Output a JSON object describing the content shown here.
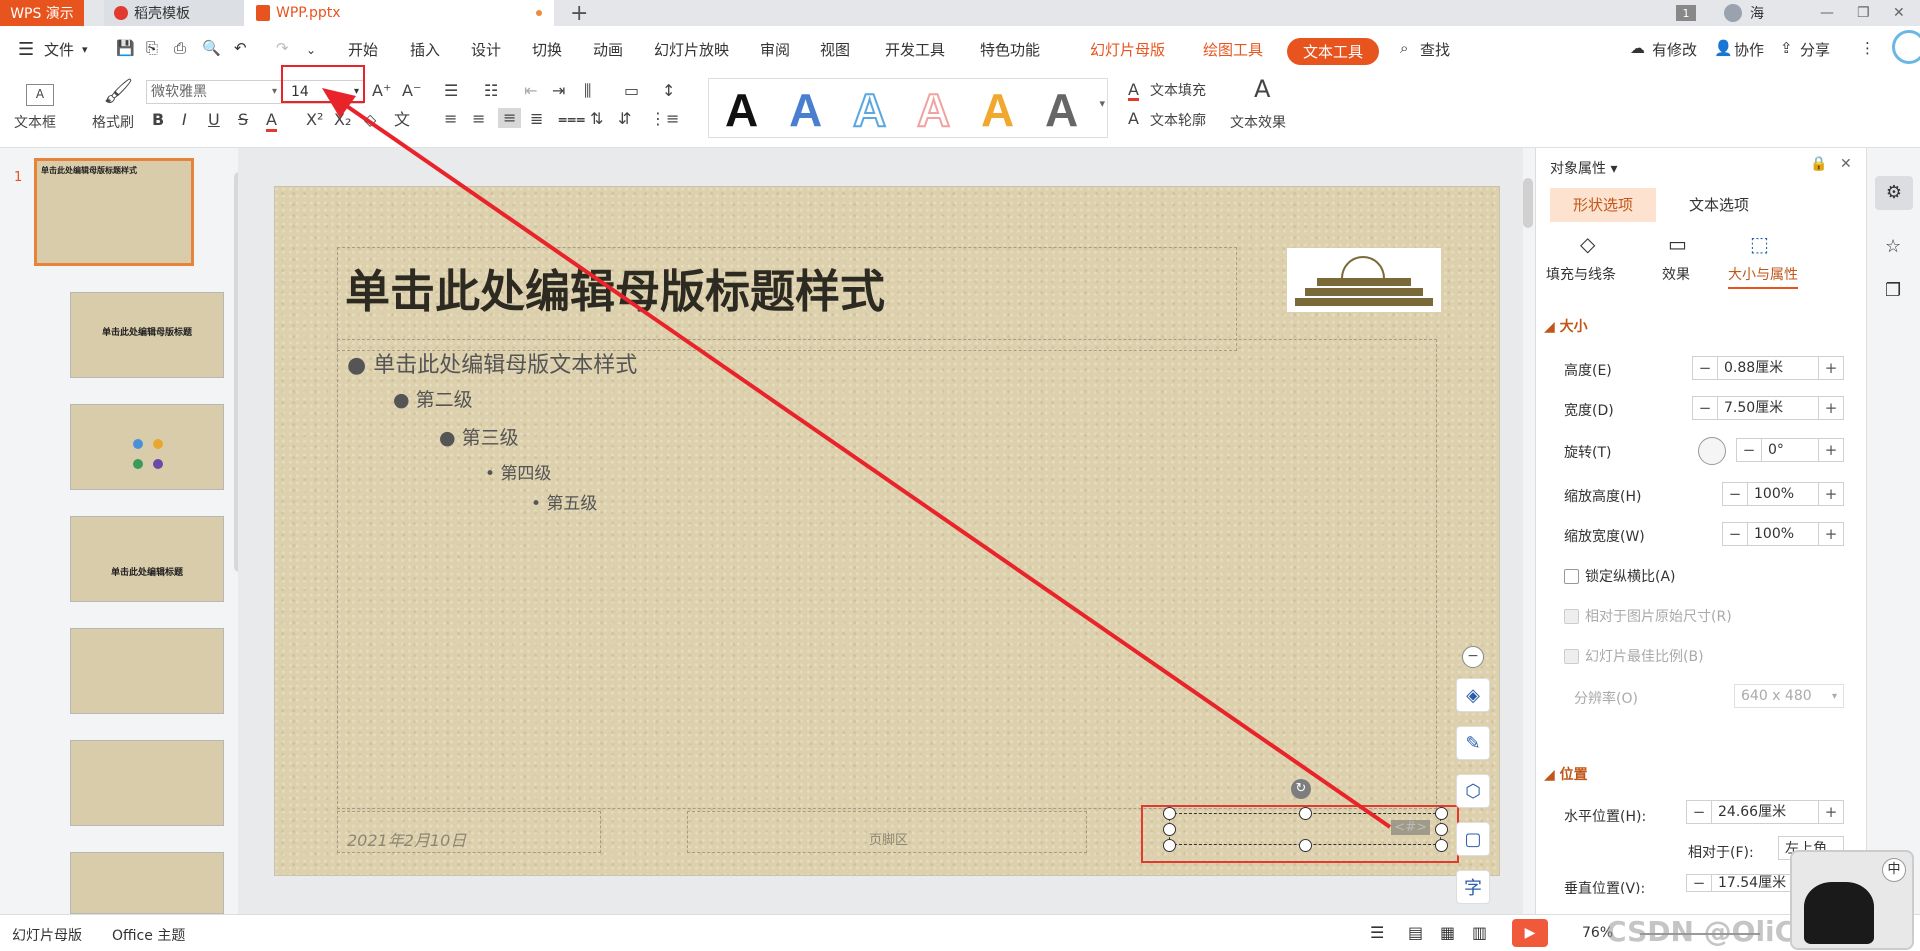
{
  "tabs": {
    "app": "WPS 演示",
    "template": "稻壳模板",
    "file": "WPP.pptx",
    "new_tab": "+",
    "page_num": "1",
    "user": "海"
  },
  "menu": {
    "file": "文件",
    "items": [
      "开始",
      "插入",
      "设计",
      "切换",
      "动画",
      "幻灯片放映",
      "审阅",
      "视图",
      "开发工具",
      "特色功能"
    ],
    "context": [
      "幻灯片母版",
      "绘图工具"
    ],
    "active": "文本工具",
    "search": "查找",
    "right": [
      "有修改",
      "协作",
      "分享"
    ]
  },
  "ribbon": {
    "textbox": "文本框",
    "format_painter": "格式刷",
    "font_name": "微软雅黑",
    "font_size": "14",
    "text_fill": "文本填充",
    "text_outline": "文本轮廓",
    "text_effect": "文本效果",
    "wordart_colors": [
      "#111111",
      "#4a7fd0",
      "#5ba7e0",
      "#f0a3a0",
      "#f0a830",
      "#666666"
    ]
  },
  "slide": {
    "title": "单击此处编辑母版标题样式",
    "levels": [
      "单击此处编辑母版文本样式",
      "第二级",
      "第三级",
      "第四级",
      "第五级"
    ],
    "date": "2021年2月10日",
    "footer": "页脚区",
    "page_num": "<#>"
  },
  "thumbs": {
    "t1_title": "单击此处编辑母版标题样式",
    "t2_title": "单击此处编辑母版标题",
    "t4_title": "单击此处编辑标题"
  },
  "panel": {
    "title": "对象属性",
    "tabs": [
      "形状选项",
      "文本选项"
    ],
    "subtabs": [
      "填充与线条",
      "效果",
      "大小与属性"
    ],
    "size_header": "大小",
    "height_label": "高度(E)",
    "height": "0.88厘米",
    "width_label": "宽度(D)",
    "width": "7.50厘米",
    "rotate_label": "旋转(T)",
    "rotate": "0°",
    "scale_h_label": "缩放高度(H)",
    "scale_h": "100%",
    "scale_w_label": "缩放宽度(W)",
    "scale_w": "100%",
    "lock_ratio": "锁定纵横比(A)",
    "relative_orig": "相对于图片原始尺寸(R)",
    "best_ratio": "幻灯片最佳比例(B)",
    "resolution_label": "分辨率(O)",
    "resolution": "640 x 480",
    "pos_header": "位置",
    "hpos_label": "水平位置(H):",
    "hpos": "24.66厘米",
    "relative_label": "相对于(F):",
    "relative": "左上角",
    "vpos_label": "垂直位置(V):",
    "vpos": "17.54厘米"
  },
  "status": {
    "view": "幻灯片母版",
    "theme": "Office 主题",
    "zoom": "76%",
    "watermark": "CSDN @OliCorrect",
    "ime": "中"
  }
}
